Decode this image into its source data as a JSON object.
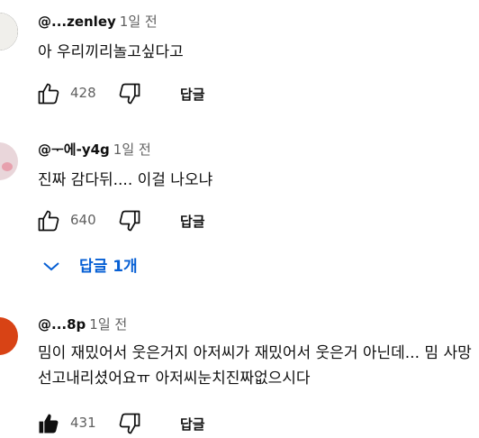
{
  "comments": [
    {
      "handle": "@...zenley",
      "time": "1일 전",
      "text": "아 우리끼리놀고싶다고",
      "likes": "428",
      "reply_label": "답글",
      "avatar_color": "#2b2b2b",
      "liked": false
    },
    {
      "handle": "@ᅮ에-y4g",
      "time": "1일 전",
      "text": "진짜 감다뒤.... 이걸 나오냐",
      "likes": "640",
      "reply_label": "답글",
      "avatar_color": "#e9d6da",
      "liked": false
    },
    {
      "handle": "@...8p",
      "time": "1일 전",
      "text": "밈이 재밌어서 웃은거지 아저씨가 재밌어서 웃은거 아닌데... 밈 사망선고내리셨어요ㅠ 아저씨눈치진짜없으시다",
      "likes": "431",
      "reply_label": "답글",
      "avatar_color": "#d84315",
      "liked": true
    }
  ],
  "replies_toggle": {
    "label": "답글 1개",
    "color": "#065fd4"
  },
  "colors": {
    "text": "#0f0f0f",
    "secondary": "#606060",
    "link": "#065fd4"
  }
}
